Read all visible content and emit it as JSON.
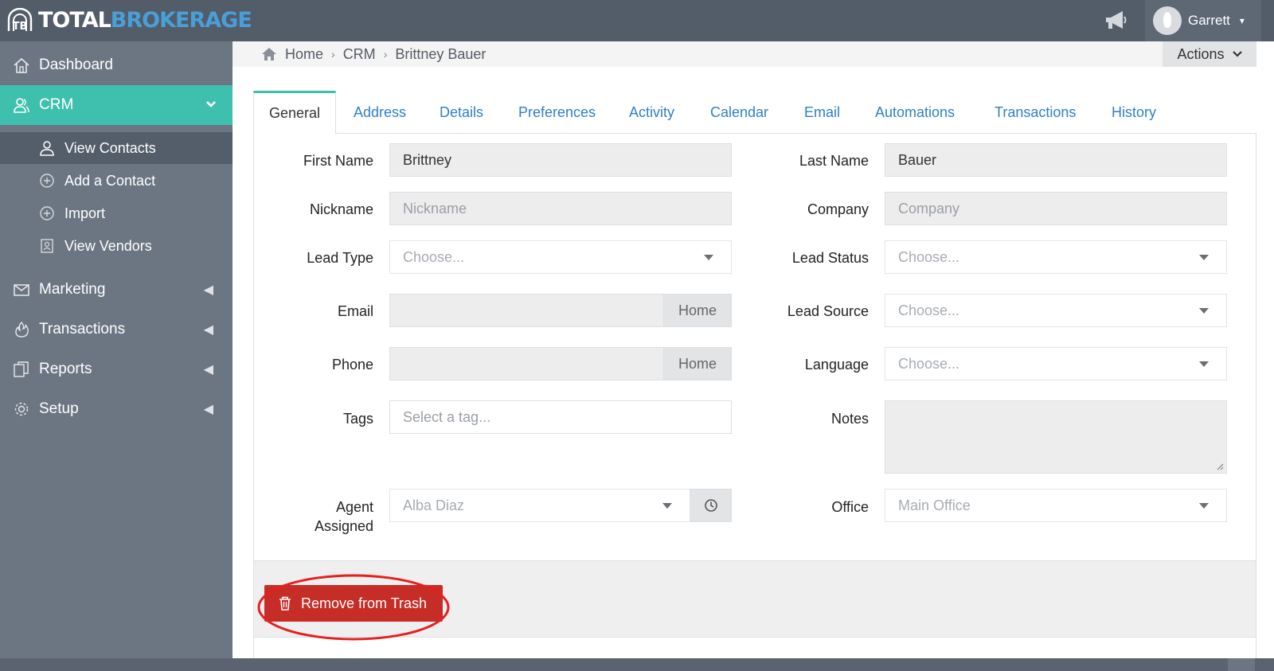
{
  "app": {
    "logo_word1": "TOTAL",
    "logo_word2": "BROKERAGE",
    "user_name": "Garrett"
  },
  "sidebar": {
    "items": [
      {
        "label": "Dashboard",
        "icon": "home-icon"
      },
      {
        "label": "CRM",
        "icon": "users-icon",
        "active": true
      },
      {
        "label": "Marketing",
        "icon": "envelope-icon"
      },
      {
        "label": "Transactions",
        "icon": "fire-icon"
      },
      {
        "label": "Reports",
        "icon": "copy-icon"
      },
      {
        "label": "Setup",
        "icon": "gear-icon"
      }
    ],
    "crm_sub": [
      {
        "label": "View Contacts",
        "icon": "user-icon",
        "active": true
      },
      {
        "label": "Add a Contact",
        "icon": "plus-circle-icon"
      },
      {
        "label": "Import",
        "icon": "plus-circle-icon"
      },
      {
        "label": "View Vendors",
        "icon": "id-card-icon"
      }
    ]
  },
  "breadcrumb": [
    "Home",
    "CRM",
    "Brittney Bauer"
  ],
  "actions_label": "Actions",
  "tabs": [
    "General",
    "Address",
    "Details",
    "Preferences",
    "Activity",
    "Calendar",
    "Email",
    "Automations",
    "Transactions",
    "History"
  ],
  "form": {
    "first_name": {
      "label": "First Name",
      "value": "Brittney"
    },
    "last_name": {
      "label": "Last Name",
      "value": "Bauer"
    },
    "nickname": {
      "label": "Nickname",
      "placeholder": "Nickname"
    },
    "company": {
      "label": "Company",
      "placeholder": "Company"
    },
    "lead_type": {
      "label": "Lead Type",
      "placeholder": "Choose..."
    },
    "lead_status": {
      "label": "Lead Status",
      "placeholder": "Choose..."
    },
    "email": {
      "label": "Email",
      "addon": "Home"
    },
    "lead_source": {
      "label": "Lead Source",
      "placeholder": "Choose..."
    },
    "phone": {
      "label": "Phone",
      "addon": "Home"
    },
    "language": {
      "label": "Language",
      "placeholder": "Choose..."
    },
    "tags": {
      "label": "Tags",
      "placeholder": "Select a tag..."
    },
    "notes": {
      "label": "Notes"
    },
    "agent_assigned": {
      "label_line1": "Agent",
      "label_line2": "Assigned",
      "value": "Alba Diaz"
    },
    "office": {
      "label": "Office",
      "value": "Main Office"
    }
  },
  "remove_button_label": "Remove from Trash",
  "colors": {
    "topbar": "#535c69",
    "sidebar": "#6c7683",
    "accent_teal": "#3fbfae",
    "link_blue": "#2f7fc6",
    "danger_red": "#c62d27",
    "highlight_red": "#e5201e"
  }
}
